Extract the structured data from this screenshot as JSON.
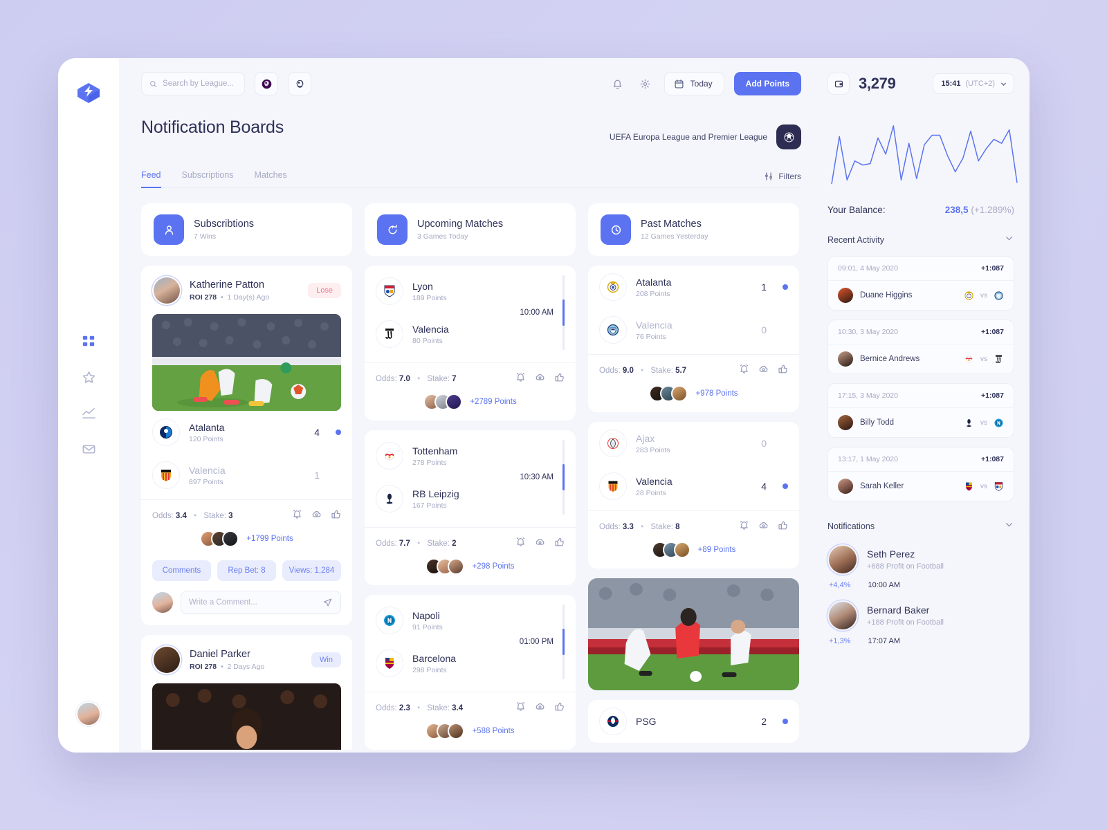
{
  "topbar": {
    "search_placeholder": "Search by League...",
    "icon_buttons": [
      "premier-league-badge",
      "europa-league-badge"
    ],
    "bell": "bell-icon",
    "gear": "gear-icon",
    "today_label": "Today",
    "add_points_label": "Add Points",
    "balance": "3,279",
    "time": "15:41",
    "timezone": "(UTC+2)"
  },
  "page": {
    "title": "Notification Boards",
    "league_label": "UEFA Europa League and Premier League",
    "tabs": [
      {
        "label": "Feed",
        "active": true
      },
      {
        "label": "Subscriptions",
        "active": false
      },
      {
        "label": "Matches",
        "active": false
      }
    ],
    "filters_label": "Filters"
  },
  "stats": [
    {
      "title": "Subscribtions",
      "sub": "7 Wins",
      "icon": "person-icon"
    },
    {
      "title": "Upcoming Matches",
      "sub": "3 Games Today",
      "icon": "timer-icon"
    },
    {
      "title": "Past Matches",
      "sub": "12 Games Yesterday",
      "icon": "clock-icon"
    }
  ],
  "feed": [
    {
      "name": "Katherine Patton",
      "roi": "ROI 278",
      "ago": "1 Day(s) Ago",
      "status": "Lose",
      "status_kind": "lose",
      "teams": [
        {
          "name": "Atalanta",
          "points": "120 Points",
          "score": "4",
          "winner": true
        },
        {
          "name": "Valencia",
          "points": "897 Points",
          "score": "1",
          "winner": false
        }
      ],
      "odds": "3.4",
      "stake": "3",
      "points": "+1799 Points",
      "chips": [
        "Comments",
        "Rep Bet: 8",
        "Views: 1,284"
      ],
      "comment_placeholder": "Write a Comment..."
    },
    {
      "name": "Daniel Parker",
      "roi": "ROI 278",
      "ago": "2 Days Ago",
      "status": "Win",
      "status_kind": "win"
    }
  ],
  "upcoming": [
    {
      "home": {
        "name": "Lyon",
        "points": "189 Points",
        "crest": "lyon-crest"
      },
      "away": {
        "name": "Valencia",
        "points": "80 Points",
        "crest": "juventus-crest"
      },
      "time": "10:00 AM",
      "odds": "7.0",
      "stake": "7",
      "points": "+2789 Points"
    },
    {
      "home": {
        "name": "Tottenham",
        "points": "278 Points",
        "crest": "rb-leipzig-crest"
      },
      "away": {
        "name": "RB Leipzig",
        "points": "167 Points",
        "crest": "tottenham-crest"
      },
      "time": "10:30 AM",
      "odds": "7.7",
      "stake": "2",
      "points": "+298 Points"
    },
    {
      "home": {
        "name": "Napoli",
        "points": "91 Points",
        "crest": "napoli-crest"
      },
      "away": {
        "name": "Barcelona",
        "points": "298 Points",
        "crest": "barcelona-crest"
      },
      "time": "01:00 PM",
      "odds": "2.3",
      "stake": "3.4",
      "points": "+588 Points"
    }
  ],
  "past": [
    {
      "home": {
        "name": "Atalanta",
        "points": "208 Points",
        "score": "1",
        "winner": true,
        "crest": "real-madrid-crest"
      },
      "away": {
        "name": "Valencia",
        "points": "76 Points",
        "score": "0",
        "winner": false,
        "crest": "man-city-crest"
      },
      "odds": "9.0",
      "stake": "5.7",
      "points": "+978 Points"
    },
    {
      "home": {
        "name": "Ajax",
        "points": "283 Points",
        "score": "0",
        "winner": false,
        "crest": "ajax-crest"
      },
      "away": {
        "name": "Valencia",
        "points": "28 Points",
        "score": "4",
        "winner": true,
        "crest": "valencia-crest"
      },
      "odds": "3.3",
      "stake": "8",
      "points": "+89 Points"
    },
    {
      "home": {
        "name": "PSG",
        "points": "",
        "score": "2",
        "winner": true,
        "crest": "psg-crest"
      }
    }
  ],
  "right": {
    "balance_label": "Your Balance:",
    "balance_value": "238,5",
    "balance_change": "(+1.289%)",
    "recent_activity_label": "Recent Activity",
    "notifications_label": "Notifications",
    "activity": [
      {
        "date": "09:01, 4 May 2020",
        "amount": "+1:087",
        "name": "Duane Higgins",
        "vs": "vs",
        "home_crest": "real-madrid-crest",
        "away_crest": "man-city-crest"
      },
      {
        "date": "10:30, 3 May 2020",
        "amount": "+1:087",
        "name": "Bernice Andrews",
        "vs": "vs",
        "home_crest": "rb-leipzig-crest",
        "away_crest": "juventus-crest"
      },
      {
        "date": "17:15, 3 May 2020",
        "amount": "+1:087",
        "name": "Billy Todd",
        "vs": "vs",
        "home_crest": "tottenham-crest",
        "away_crest": "napoli-crest"
      },
      {
        "date": "13:17, 1 May 2020",
        "amount": "+1:087",
        "name": "Sarah Keller",
        "vs": "vs",
        "home_crest": "barcelona-crest",
        "away_crest": "lyon-crest"
      }
    ],
    "notifications": [
      {
        "name": "Seth Perez",
        "sub": "+688 Profit on Football",
        "pct": "+4,4%",
        "time": "10:00 AM"
      },
      {
        "name": "Bernard Baker",
        "sub": "+188 Profit on Football",
        "pct": "+1,3%",
        "time": "17:07 AM"
      }
    ]
  },
  "chart_data": {
    "type": "line",
    "title": "",
    "xlabel": "",
    "ylabel": "",
    "grid": false,
    "legend": "none",
    "color": "#5b73f0",
    "x": [
      0,
      1,
      2,
      3,
      4,
      5,
      6,
      7,
      8,
      9,
      10,
      11,
      12,
      13,
      14,
      15,
      16,
      17,
      18,
      19,
      20,
      21,
      22,
      23,
      24
    ],
    "values": [
      2,
      72,
      8,
      36,
      30,
      32,
      70,
      46,
      88,
      8,
      62,
      10,
      60,
      74,
      74,
      44,
      20,
      40,
      80,
      36,
      54,
      68,
      62,
      82,
      4
    ],
    "ylim": [
      0,
      100
    ]
  }
}
